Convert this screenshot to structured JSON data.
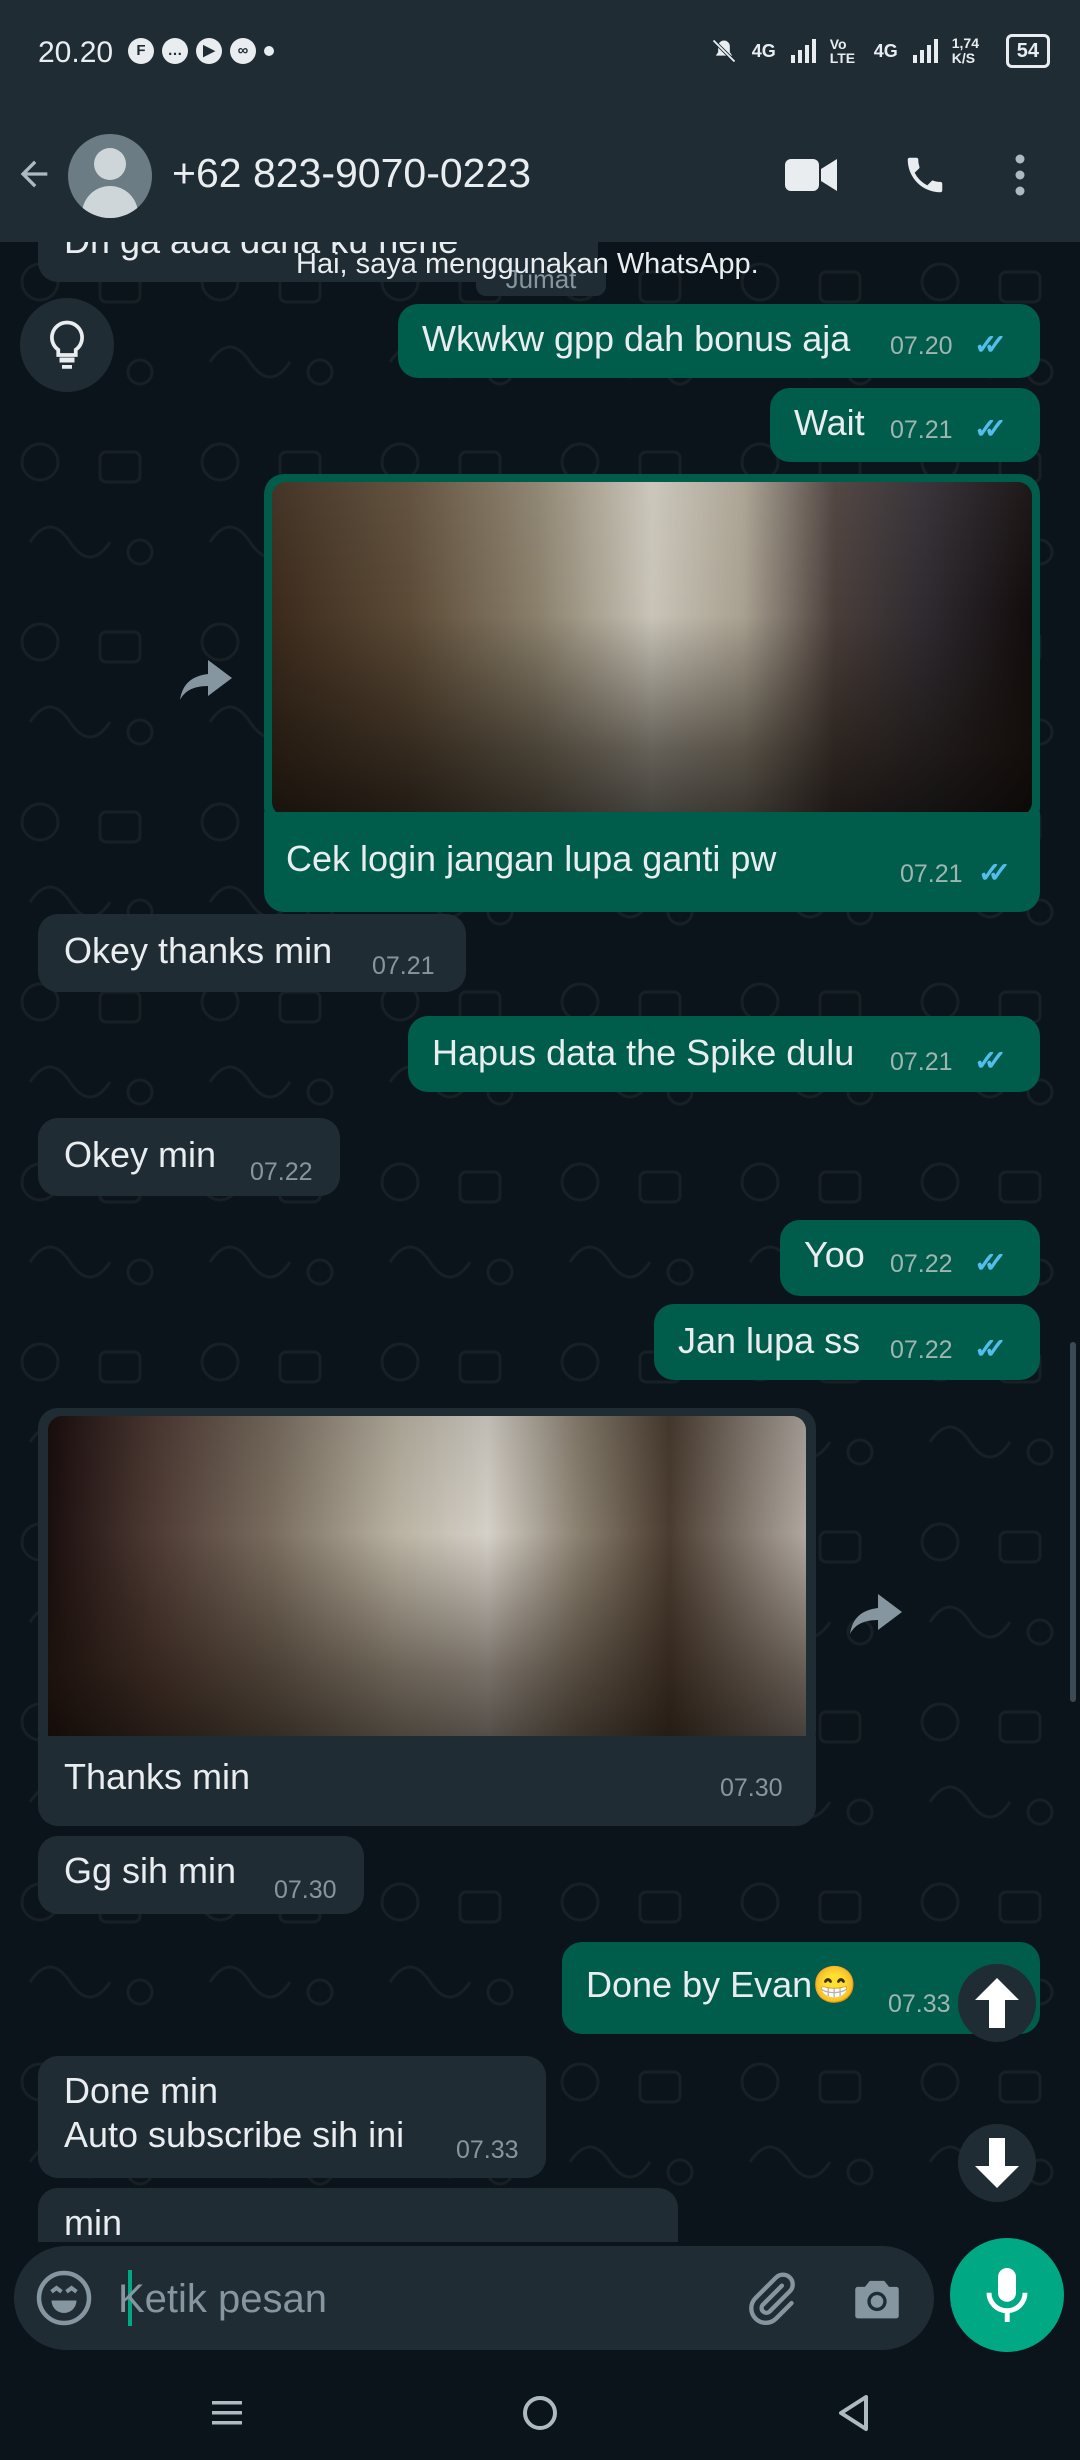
{
  "status_bar": {
    "time": "20.20",
    "left_icons": [
      "ff-app-icon",
      "chat-app-icon",
      "youtube-icon",
      "link-app-icon"
    ],
    "network": "4G",
    "volte": "Vo LTE",
    "speed": "1,74 K/S",
    "battery": "54"
  },
  "header": {
    "contact": "+62 823-9070-0223",
    "icons": [
      "back-arrow-icon",
      "video-call-icon",
      "voice-call-icon",
      "more-vert-icon"
    ]
  },
  "chat": {
    "partial_top_text": "Dri ga ada dana ku nene",
    "date_chip": "Jumat",
    "about_notice": "Hai, saya menggunakan WhatsApp.",
    "messages": [
      {
        "dir": "out",
        "text": "Wkwkw gpp dah bonus aja",
        "time": "07.20"
      },
      {
        "dir": "out",
        "text": "Wait",
        "time": "07.21"
      },
      {
        "dir": "out",
        "type": "image",
        "caption": "Cek login jangan lupa ganti pw",
        "time": "07.21"
      },
      {
        "dir": "in",
        "text": "Okey thanks min",
        "time": "07.21"
      },
      {
        "dir": "out",
        "text": "Hapus data the Spike dulu",
        "time": "07.21"
      },
      {
        "dir": "in",
        "text": "Okey min",
        "time": "07.22"
      },
      {
        "dir": "out",
        "text": "Yoo",
        "time": "07.22"
      },
      {
        "dir": "out",
        "text": "Jan lupa ss",
        "time": "07.22"
      },
      {
        "dir": "in",
        "type": "image",
        "caption": "Thanks min",
        "time": "07.30"
      },
      {
        "dir": "in",
        "text": "Gg sih min",
        "time": "07.30"
      },
      {
        "dir": "out",
        "text": "Done by Evan😁",
        "time": "07.33"
      },
      {
        "dir": "in",
        "text_line1": "Done min",
        "text_line2": "Auto subscribe sih ini",
        "time": "07.33"
      },
      {
        "dir": "in",
        "text": "min",
        "partial": true
      }
    ]
  },
  "composer": {
    "placeholder": "Ketik pesan",
    "icons": [
      "emoji-icon",
      "attach-icon",
      "camera-icon",
      "mic-icon"
    ]
  },
  "nav_bar": {
    "icons": [
      "recents-icon",
      "home-icon",
      "back-icon"
    ]
  },
  "colors": {
    "background": "#0b141a",
    "header": "#1f2c34",
    "outgoing_bubble": "#005c4b",
    "incoming_bubble": "#202c33",
    "accent": "#00a884",
    "read_ticks": "#53bdeb"
  }
}
